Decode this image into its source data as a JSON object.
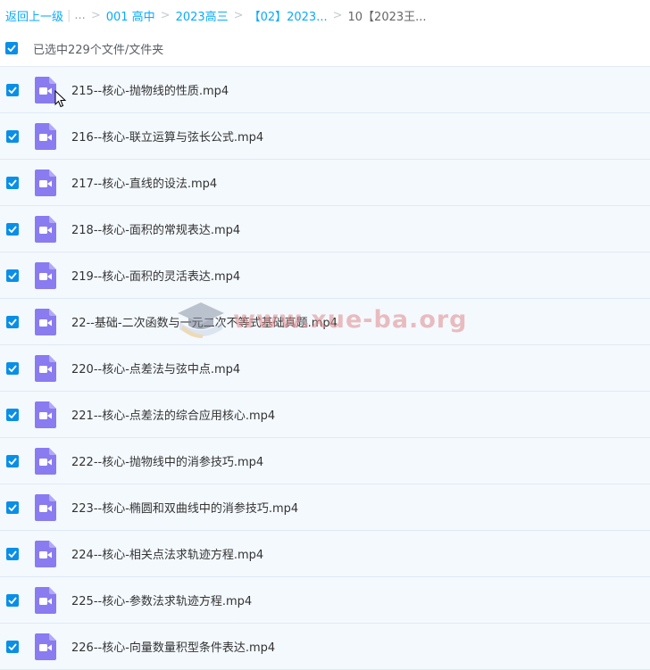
{
  "breadcrumb": {
    "back": "返回上一级",
    "ellipsis": "...",
    "crumbs": [
      "001 高中",
      "2023高三",
      "【02】2023..."
    ],
    "current": "10【2023王..."
  },
  "selection": {
    "text": "已选中229个文件/文件夹"
  },
  "files": [
    "215--核心-抛物线的性质.mp4",
    "216--核心-联立运算与弦长公式.mp4",
    "217--核心-直线的设法.mp4",
    "218--核心-面积的常规表达.mp4",
    "219--核心-面积的灵活表达.mp4",
    "22--基础-二次函数与一元二次不等式基础真题.mp4",
    "220--核心-点差法与弦中点.mp4",
    "221--核心-点差法的综合应用核心.mp4",
    "222--核心-抛物线中的消参技巧.mp4",
    "223--核心-椭圆和双曲线中的消参技巧.mp4",
    "224--核心-相关点法求轨迹方程.mp4",
    "225--核心-参数法求轨迹方程.mp4",
    "226--核心-向量数量积型条件表达.mp4"
  ],
  "watermark": "www.xue-ba.org",
  "icons": {
    "file": "video-file-icon",
    "check": "checkbox-checked-icon",
    "cursor": "mouse-pointer-icon"
  },
  "colors": {
    "link": "#09aaff",
    "checkbox": "#0a8fe7",
    "video_icon": "#8a7bf0",
    "row_bg": "#f4f9fe"
  }
}
